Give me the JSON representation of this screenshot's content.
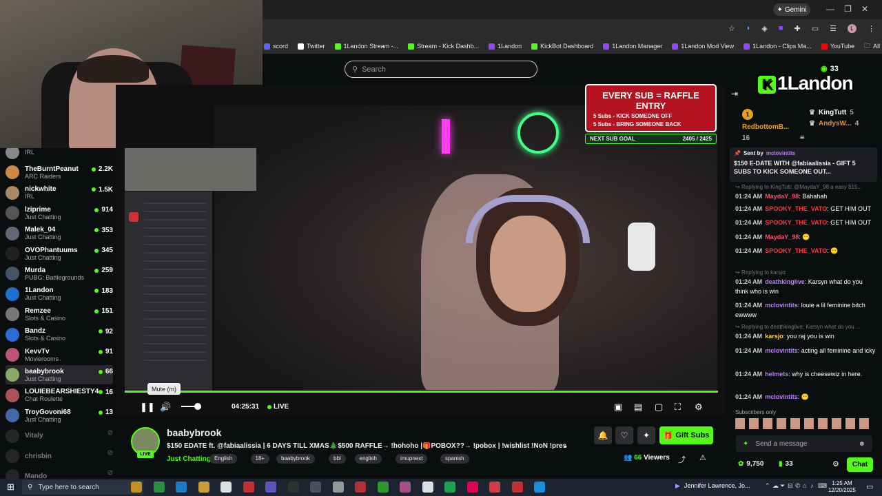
{
  "browser": {
    "gemini_label": "Gemini",
    "bookmarks": [
      {
        "label": "scord",
        "color": "#5865f2"
      },
      {
        "label": "Twitter",
        "color": "#ffffff"
      },
      {
        "label": "1Landon Stream -...",
        "color": "#53fc18"
      },
      {
        "label": "Stream - Kick Dashb...",
        "color": "#53fc18"
      },
      {
        "label": "1Landon",
        "color": "#9146ff"
      },
      {
        "label": "KickBot Dashboard",
        "color": "#53fc18"
      },
      {
        "label": "1Landon Manager",
        "color": "#9146ff"
      },
      {
        "label": "1Landon Mod View",
        "color": "#9146ff"
      },
      {
        "label": "1Landon - Clips Ma...",
        "color": "#9146ff"
      },
      {
        "label": "YouTube",
        "color": "#ff0000"
      }
    ],
    "all_bookmarks": "All Bookmarks"
  },
  "search": {
    "placeholder": "Search"
  },
  "sidebar": {
    "items": [
      {
        "name": "",
        "category": "IRL",
        "viewers": "",
        "color": "#888"
      },
      {
        "name": "TheBurntPeanut",
        "category": "ARC Raiders",
        "viewers": "2.2K",
        "color": "#c84"
      },
      {
        "name": "nickwhite",
        "category": "IRL",
        "viewers": "1.5K",
        "color": "#a86"
      },
      {
        "name": "lziprime",
        "category": "Just Chatting",
        "viewers": "914",
        "color": "#555"
      },
      {
        "name": "Malek_04",
        "category": "Just Chatting",
        "viewers": "353",
        "color": "#667"
      },
      {
        "name": "OVOPhantuums",
        "category": "Just Chatting",
        "viewers": "345",
        "color": "#222"
      },
      {
        "name": "Murda",
        "category": "PUBG: Battlegrounds",
        "viewers": "259",
        "color": "#456"
      },
      {
        "name": "1Landon",
        "category": "Just Chatting",
        "viewers": "183",
        "color": "#1f6fd1"
      },
      {
        "name": "Remzee",
        "category": "Slots & Casino",
        "viewers": "151",
        "color": "#777"
      },
      {
        "name": "Bandz",
        "category": "Slots & Casino",
        "viewers": "92",
        "color": "#2a6bd8"
      },
      {
        "name": "KevvTv",
        "category": "Movierooms",
        "viewers": "91",
        "color": "#b57"
      },
      {
        "name": "baabybrook",
        "category": "Just Chatting",
        "viewers": "66",
        "color": "#8a6"
      },
      {
        "name": "LOUIEBEARSHIESTY4",
        "category": "Chat Roulette",
        "viewers": "16",
        "color": "#a55"
      },
      {
        "name": "TroyGovoni68",
        "category": "Just Chatting",
        "viewers": "13",
        "color": "#46a"
      },
      {
        "name": "Vitaly",
        "category": "",
        "viewers": "",
        "color": "#444"
      },
      {
        "name": "chrisbin",
        "category": "",
        "viewers": "",
        "color": "#444"
      },
      {
        "name": "Mando",
        "category": "",
        "viewers": "",
        "color": "#444"
      }
    ]
  },
  "overlay": {
    "raffle_title": "EVERY SUB = RAFFLE ENTRY",
    "raffle_line1": "5 Subs - KICK SOMEONE OFF",
    "raffle_line2": "5 Subs - BRING SOMEONE BACK",
    "subgoal_label": "NEXT SUB GOAL",
    "subgoal_value": "2405 / 2425",
    "subgoal_progress": 0.99
  },
  "player": {
    "mute_tooltip": "Mute (m)",
    "time": "04:25:31",
    "live": "LIVE",
    "progress": 1.0
  },
  "channel": {
    "name": "baabybrook",
    "live_badge": "LIVE",
    "title": "$150 EDATE ft. @fabiaalissia | 6 DAYS TILL XMAS🎄$500 RAFFLE→ !hohoho |🎁POBOX??→ !pobox | !wishlist !NoN !present ...",
    "category": "Just Chatting",
    "tags": [
      "English",
      "18+",
      "baabybrook",
      "bbl",
      "english",
      "imupnext",
      "spanish"
    ],
    "gift_subs": "Gift Subs",
    "viewers_count": "66",
    "viewers_label": "Viewers"
  },
  "chat": {
    "viewer_count": "33",
    "logo_text": "1Landon",
    "leaderboard": [
      {
        "rank": "1",
        "name": "RedbottomB...",
        "value": "16"
      },
      {
        "rank": "",
        "name": "KingTutt",
        "value": "5"
      },
      {
        "rank": "",
        "name": "AndysW...",
        "value": "4"
      }
    ],
    "pinned_sender_label": "Sent by",
    "pinned_sender": "mclovintits",
    "pinned_text": "$150 E-DATE WITH @fabiaalissia - GIFT 5 SUBS TO KICK SOMEONE OUT...",
    "messages": [
      {
        "reply": "Replying to KingTutt: @MaydaY_98 a easy $15..."
      },
      {
        "ts": "01:24 AM",
        "user": "MaydaY_98",
        "color": "#ff4d6d",
        "text": ": Bahahah"
      },
      {
        "ts": "01:24 AM",
        "user": "SPOOKY_THE_VATO",
        "color": "#ff3b3b",
        "text": ": GET HIM OUT"
      },
      {
        "ts": "01:24 AM",
        "user": "SPOOKY_THE_VATO",
        "color": "#ff3b3b",
        "text": ": GET HIM OUT"
      },
      {
        "ts": "01:24 AM",
        "user": "MaydaY_98",
        "color": "#ff4d6d",
        "text": ":"
      },
      {
        "ts": "01:24 AM",
        "user": "SPOOKY_THE_VATO",
        "color": "#ff3b3b",
        "text": ":"
      },
      {
        "reply": "Replying to karsjo:"
      },
      {
        "ts": "01:24 AM",
        "user": "deathkinglive",
        "color": "#c07cff",
        "text": ": Karsyn what do you think who is win"
      },
      {
        "ts": "01:24 AM",
        "user": "mclovintits",
        "color": "#c07cff",
        "text": ": louie a lil feminine bitch ewwww"
      },
      {
        "reply": "Replying to deathkinglive: Karsyn what do you ..."
      },
      {
        "ts": "01:24 AM",
        "user": "karsjo",
        "color": "#ffd23b",
        "text": ": you raj you is win"
      },
      {
        "ts": "01:24 AM",
        "user": "mclovintits",
        "color": "#c07cff",
        "text": ": acting all feminine and icky"
      },
      {
        "ts": "01:24 AM",
        "user": "helmets",
        "color": "#c07cff",
        "text": ": why is cheesewiz in here."
      },
      {
        "ts": "01:24 AM",
        "user": "mclovintits",
        "color": "#c07cff",
        "text": ":"
      }
    ],
    "subscribers_only": "Subscribers only",
    "input_placeholder": "Send a message",
    "points": "9,750",
    "bottom_count": "33",
    "chat_button": "Chat"
  },
  "taskbar": {
    "search_placeholder": "Type here to search",
    "media_title": "Jennifer Lawrence, Jo...",
    "time": "1:25 AM",
    "date": "12/20/2025"
  }
}
